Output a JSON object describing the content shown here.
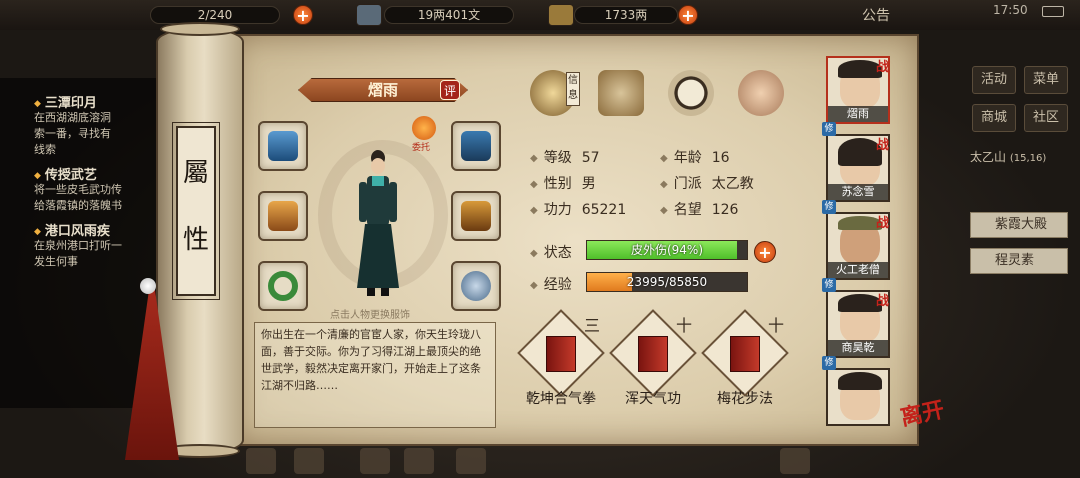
{
  "top": {
    "stamina": "2/240",
    "copper": "19两401文",
    "silver": "1733两",
    "notice": "公告",
    "time": "17:50"
  },
  "quests": [
    {
      "title": "三潭印月",
      "desc": "在西湖湖底溶洞\n索一番，寻找有\n线索"
    },
    {
      "title": "传授武艺",
      "desc": "将一些皮毛武功传\n给落霞镇的落魄书"
    },
    {
      "title": "港口风雨疾",
      "desc": "在泉州港口打听一\n发生何事"
    }
  ],
  "right_menu": {
    "activity": "活动",
    "menu": "菜单",
    "mall": "商城",
    "community": "社区",
    "location": "太乙山",
    "coords": "(15,16)",
    "list": [
      "紫霞大殿",
      "程灵素"
    ]
  },
  "scroll": {
    "title": "属性"
  },
  "character": {
    "name": "熠雨",
    "eval_label": "评",
    "entrust_label": "委托",
    "hint": "点击人物更换服饰",
    "bio": "你出生在一个清廉的官宦人家，你天生玲珑八面，善于交际。你为了习得江湖上最顶尖的绝世武学，毅然决定离开家门，开始走上了这条江湖不归路……",
    "info_badge": "信息"
  },
  "stats": {
    "level_label": "等级",
    "level": "57",
    "age_label": "年龄",
    "age": "16",
    "gender_label": "性别",
    "gender": "男",
    "sect_label": "门派",
    "sect": "太乙教",
    "power_label": "功力",
    "power": "65221",
    "fame_label": "名望",
    "fame": "126",
    "status_label": "状态",
    "status_text": "皮外伤(94%)",
    "status_pct": 0.94,
    "exp_label": "经验",
    "exp_text": "23995/85850",
    "exp_pct": 0.2795
  },
  "skills": [
    {
      "name": "乾坤合气拳",
      "mark": "三"
    },
    {
      "name": "浑天气功",
      "mark": "十"
    },
    {
      "name": "梅花步法",
      "mark": "十"
    }
  ],
  "companions": [
    {
      "name": "熠雨",
      "battle": "战",
      "train": "修"
    },
    {
      "name": "苏念雪",
      "battle": "战",
      "train": "修"
    },
    {
      "name": "火工老僧",
      "battle": "战",
      "train": "修"
    },
    {
      "name": "商昊乾",
      "battle": "战",
      "train": "修"
    },
    {
      "name": "",
      "battle": "",
      "train": ""
    }
  ],
  "leave_label": "离开",
  "colors": {
    "hp": "#4fbf2a",
    "exp": "#e07a1e",
    "accent": "#b5301c"
  }
}
